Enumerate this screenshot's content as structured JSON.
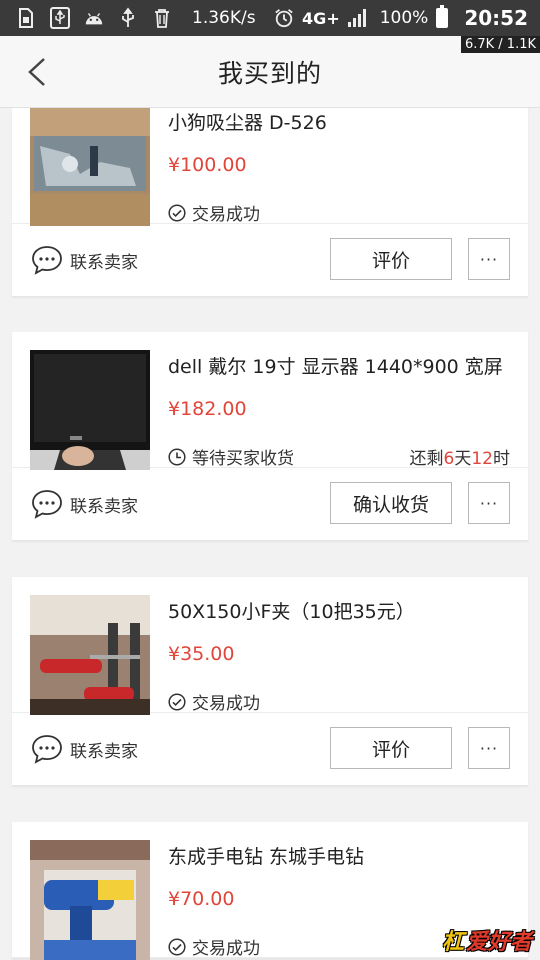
{
  "status_bar": {
    "speed": "1.36K/s",
    "network": "4G+",
    "battery": "100%",
    "time": "20:52",
    "traffic": "6.7K / 1.1K",
    "icons": [
      "sim-icon",
      "usb-icon",
      "android-icon",
      "usb-debug-icon",
      "trash-icon",
      "alarm-icon",
      "signal-icon",
      "battery-icon"
    ]
  },
  "header": {
    "title": "我买到的",
    "back_icon": "chevron-left-icon"
  },
  "orders": [
    {
      "title": "小狗吸尘器 D-526",
      "price": "¥100.00",
      "status": "交易成功",
      "status_icon": "check-circle-icon",
      "contact": "联系卖家",
      "action": "评价",
      "more": "···"
    },
    {
      "title": "dell 戴尔 19寸  显示器 1440*900 宽屏",
      "price": "¥182.00",
      "status": "等待买家收货",
      "status_icon": "clock-icon",
      "remain_prefix": "还剩",
      "remain_days": "6",
      "remain_days_unit": "天",
      "remain_hours": "12",
      "remain_hours_unit": "时",
      "contact": "联系卖家",
      "action": "确认收货",
      "more": "···"
    },
    {
      "title": "50X150小F夹（10把35元）",
      "price": "¥35.00",
      "status": "交易成功",
      "status_icon": "check-circle-icon",
      "contact": "联系卖家",
      "action": "评价",
      "more": "···"
    },
    {
      "title": "东成手电钻 东城手电钻",
      "price": "¥70.00",
      "status": "交易成功",
      "status_icon": "check-circle-icon"
    }
  ],
  "watermark": {
    "part1": "杠",
    "part2": "爱好者"
  },
  "colors": {
    "price": "#e0463a",
    "status_bar": "#3a3a3a",
    "header_bg": "#f7f7f7"
  }
}
